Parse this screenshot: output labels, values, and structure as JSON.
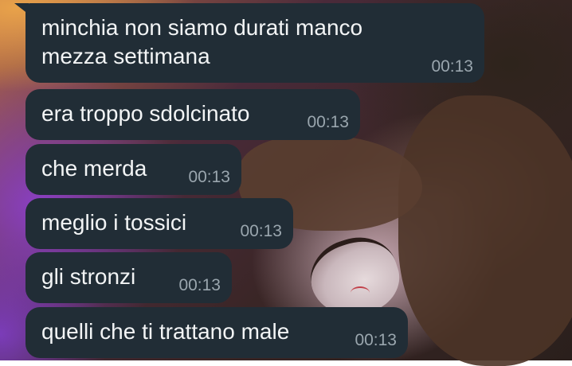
{
  "colors": {
    "bubble_bg": "#212d36",
    "message_text": "#f2f4f5",
    "timestamp_text": "#9aa6ae"
  },
  "messages": [
    {
      "text": "minchia non siamo durati manco\nmezza settimana",
      "time": "00:13"
    },
    {
      "text": "era troppo sdolcinato",
      "time": "00:13"
    },
    {
      "text": "che merda",
      "time": "00:13"
    },
    {
      "text": "meglio i tossici",
      "time": "00:13"
    },
    {
      "text": "gli stronzi",
      "time": "00:13"
    },
    {
      "text": "quelli che ti trattano male",
      "time": "00:13"
    }
  ]
}
